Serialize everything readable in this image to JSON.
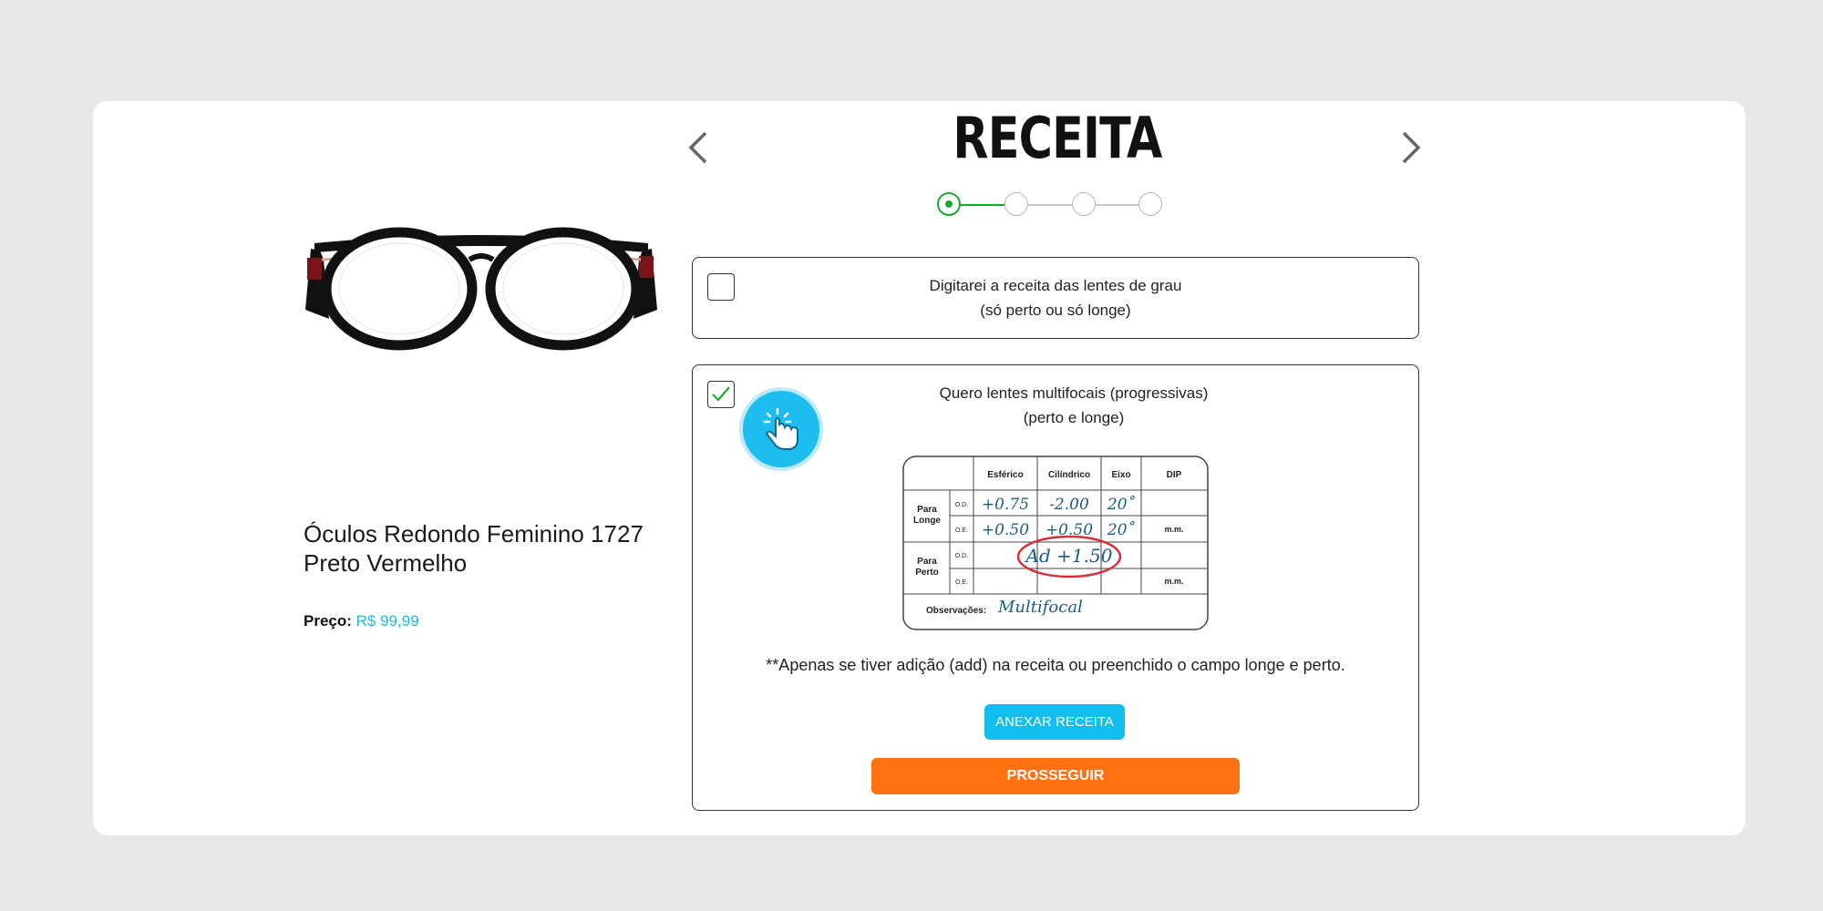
{
  "header": {
    "title": "RECEITA"
  },
  "stepper": {
    "total_steps": 4,
    "current_step": 1
  },
  "product": {
    "name": "Óculos Redondo Feminino 1727 Preto Vermelho",
    "price_label": "Preço:",
    "price_value": "R$ 99,99"
  },
  "options": [
    {
      "line1": "Digitarei a receita das lentes de grau",
      "line2": "(só perto ou só longe)",
      "checked": false
    },
    {
      "line1": "Quero lentes multifocais (progressivas)",
      "line2": "(perto e longe)",
      "checked": true
    }
  ],
  "prescription_example": {
    "headers": [
      "Esférico",
      "Cilíndrico",
      "Eixo",
      "DIP"
    ],
    "row_groups": [
      "Para Longe",
      "Para Perto"
    ],
    "eyes": [
      "O.D.",
      "O.E."
    ],
    "values": {
      "longe_od": [
        "+0.75",
        "-2.00",
        "20˚"
      ],
      "longe_oe": [
        "+0.50",
        "+0.50",
        "20˚"
      ],
      "dip_unit": "m.m.",
      "addition": "Ad +1.50",
      "observacoes_label": "Observações:",
      "observacoes_value": "Multifocal"
    }
  },
  "note": "**Apenas se tiver adição (add) na receita ou preenchido o campo longe e perto.",
  "buttons": {
    "attach": "ANEXAR RECEITA",
    "continue": "PROSSEGUIR"
  },
  "colors": {
    "accent_blue": "#14bdf0",
    "accent_orange": "#ff7112",
    "step_green": "#1ba82f",
    "price_blue": "#22b8e8"
  },
  "icons": [
    "chevron-left-icon",
    "chevron-right-icon",
    "check-icon",
    "tap-hand-icon"
  ]
}
